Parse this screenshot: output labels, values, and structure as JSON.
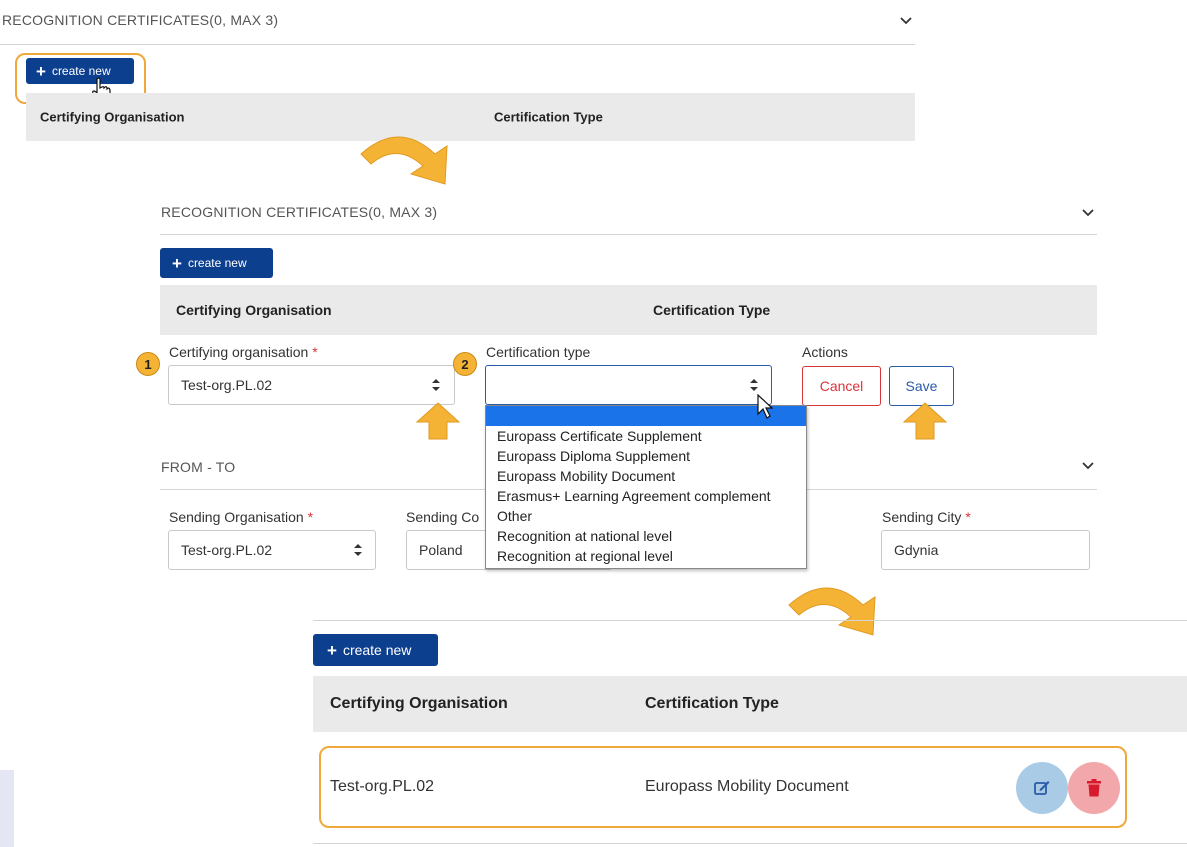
{
  "step1": {
    "section_title": "RECOGNITION CERTIFICATES(0, MAX 3)",
    "create_label": "create new",
    "col_org": "Certifying Organisation",
    "col_type": "Certification Type"
  },
  "step2": {
    "section_title": "RECOGNITION CERTIFICATES(0, MAX 3)",
    "create_label": "create new",
    "col_org": "Certifying Organisation",
    "col_type": "Certification Type",
    "badge1": "1",
    "badge2": "2",
    "org_label": "Certifying organisation",
    "org_required": "*",
    "org_value": "Test-org.PL.02",
    "type_label": "Certification type",
    "type_value": "",
    "actions_label": "Actions",
    "cancel_label": "Cancel",
    "save_label": "Save",
    "type_options": [
      "",
      "Europass Certificate Supplement",
      "Europass Diploma Supplement",
      "Europass Mobility Document",
      "Erasmus+ Learning Agreement complement",
      "Other",
      "Recognition at national level",
      "Recognition at regional level"
    ],
    "fromto_title": "FROM - TO",
    "sending_org_label": "Sending Organisation",
    "sending_org_required": "*",
    "sending_org_value": "Test-org.PL.02",
    "sending_country_label": "Sending Co",
    "sending_country_value": "Poland",
    "sending_city_label": "Sending City",
    "sending_city_required": "*",
    "sending_city_value": "Gdynia"
  },
  "step3": {
    "create_label": "create new",
    "col_org": "Certifying Organisation",
    "col_type": "Certification Type",
    "row": {
      "org": "Test-org.PL.02",
      "type": "Europass Mobility Document"
    }
  },
  "colors": {
    "primary": "#0d3f8f",
    "highlight": "#f0a83a",
    "danger": "#d9343a",
    "edit": "#a9cbe6",
    "delete_bg": "#f2a7ab"
  },
  "icons": [
    "plus-icon",
    "hand-cursor-icon",
    "arrow-cursor-icon",
    "chevron-down-icon",
    "sort-icon",
    "up-arrow-icon",
    "curved-arrow-icon",
    "edit-icon",
    "trash-icon"
  ]
}
